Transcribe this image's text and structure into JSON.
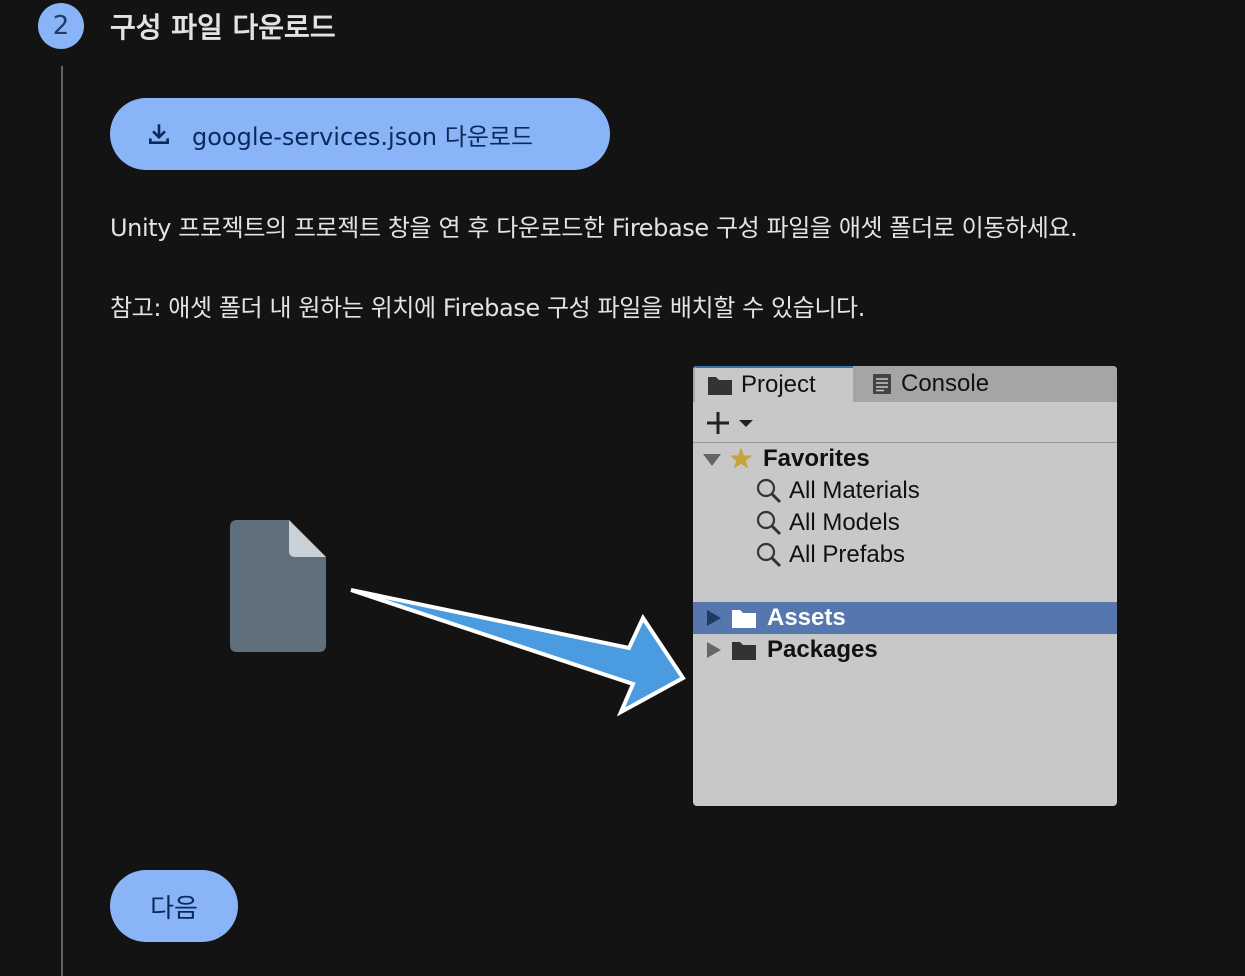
{
  "step": {
    "number": "2",
    "title": "구성 파일 다운로드"
  },
  "download_button": {
    "label": "google-services.json 다운로드",
    "icon": "download-icon"
  },
  "instruction": "Unity 프로젝트의 프로젝트 창을 연 후 다운로드한 Firebase 구성 파일을 애셋 폴더로 이동하세요.",
  "note": "참고: 애셋 폴더 내 원하는 위치에 Firebase 구성 파일을 배치할 수 있습니다.",
  "unity_panel": {
    "tabs": [
      {
        "label": "Project",
        "icon": "folder-icon"
      },
      {
        "label": "Console",
        "icon": "console-icon"
      }
    ],
    "favorites": {
      "label": "Favorites",
      "items": [
        "All Materials",
        "All Models",
        "All Prefabs"
      ]
    },
    "folders": [
      {
        "label": "Assets",
        "selected": true
      },
      {
        "label": "Packages",
        "selected": false
      }
    ]
  },
  "next_button": {
    "label": "다음"
  },
  "colors": {
    "background": "#131314",
    "accent": "#8ab4f8",
    "selection": "#5677ad",
    "arrow": "#4a9be0"
  }
}
